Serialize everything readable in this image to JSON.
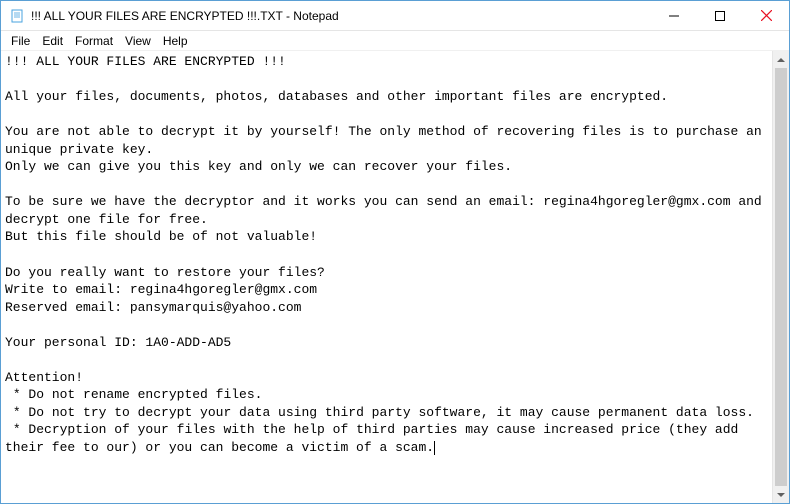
{
  "window": {
    "title": "!!! ALL YOUR FILES ARE ENCRYPTED !!!.TXT - Notepad"
  },
  "menu": {
    "file": "File",
    "edit": "Edit",
    "format": "Format",
    "view": "View",
    "help": "Help"
  },
  "document": {
    "text": "!!! ALL YOUR FILES ARE ENCRYPTED !!!\n\nAll your files, documents, photos, databases and other important files are encrypted.\n\nYou are not able to decrypt it by yourself! The only method of recovering files is to purchase an unique private key.\nOnly we can give you this key and only we can recover your files.\n\nTo be sure we have the decryptor and it works you can send an email: regina4hgoregler@gmx.com and decrypt one file for free.\nBut this file should be of not valuable!\n\nDo you really want to restore your files?\nWrite to email: regina4hgoregler@gmx.com\nReserved email: pansymarquis@yahoo.com\n\nYour personal ID: 1A0-ADD-AD5\n\nAttention!\n * Do not rename encrypted files.\n * Do not try to decrypt your data using third party software, it may cause permanent data loss.\n * Decryption of your files with the help of third parties may cause increased price (they add their fee to our) or you can become a victim of a scam."
  }
}
